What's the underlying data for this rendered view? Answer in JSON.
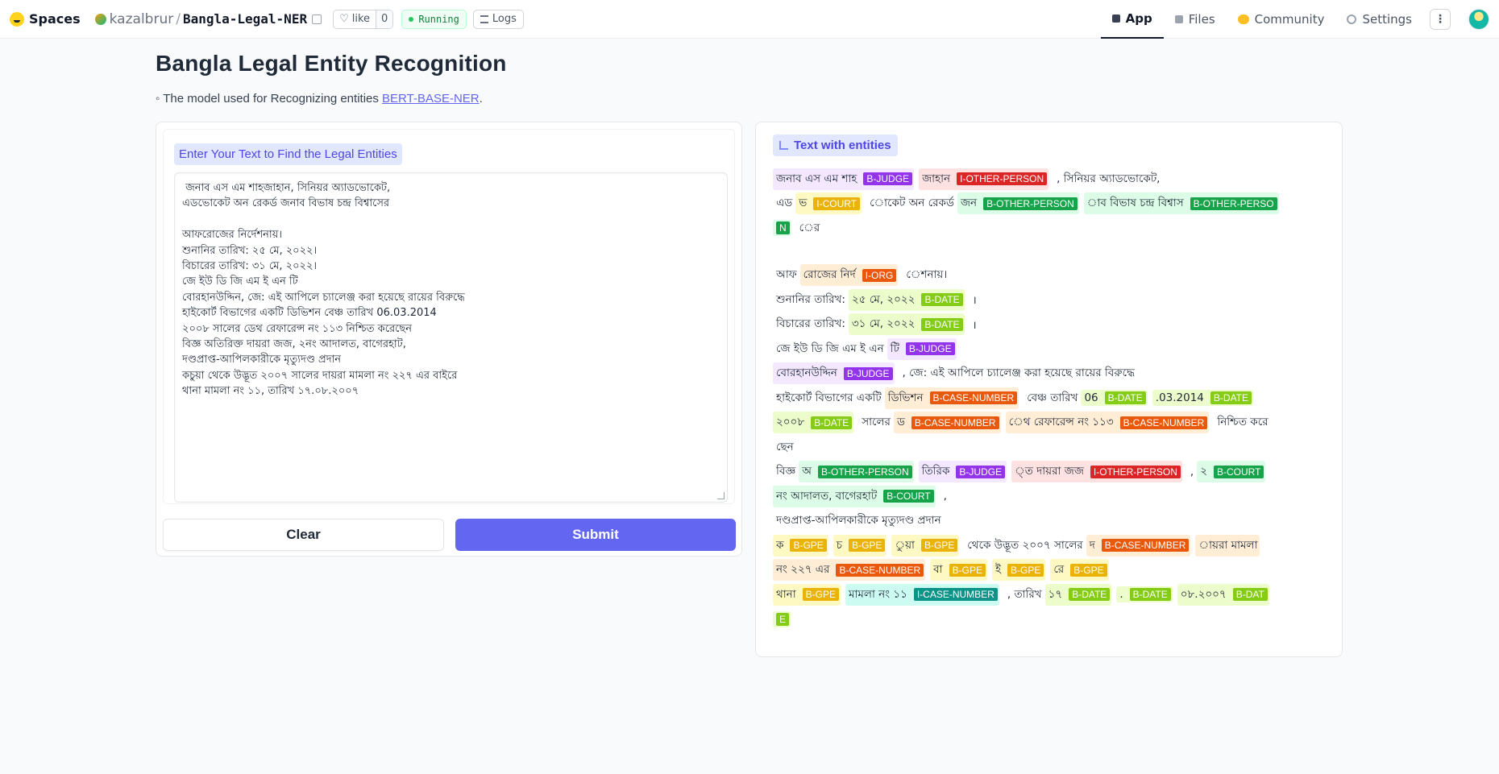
{
  "header": {
    "brand": "Spaces",
    "owner": "kazalbrur",
    "repo": "Bangla-Legal-NER",
    "like_label": "like",
    "like_count": "0",
    "status": "Running",
    "logs_label": "Logs",
    "tabs": [
      {
        "label": "App",
        "icon": "app-icon",
        "active": true
      },
      {
        "label": "Files",
        "icon": "files-icon",
        "active": false
      },
      {
        "label": "Community",
        "icon": "community-icon",
        "active": false
      },
      {
        "label": "Settings",
        "icon": "settings-icon",
        "active": false
      }
    ]
  },
  "page": {
    "title": "Bangla Legal Entity Recognition",
    "desc_prefix": "The model used for Recognizing entities",
    "desc_link": "BERT-BASE-NER",
    "desc_suffix": "."
  },
  "input": {
    "label": "Enter Your Text to Find the Legal Entities",
    "lines": [
      " জনাব এস এম শাহজাহান, সিনিয়র অ্যাডভোকেট,",
      "এডভোকেট অন রেকর্ড জনাব বিভাষ চন্দ্র বিশ্বাসের",
      "",
      "আফরোজের নির্দেশনায়।",
      "শুনানির তারিখ: ২৫ মে, ২০২২।",
      "বিচারের তারিখ: ৩১ মে, ২০২২।",
      "জে ইউ ডি জি এম ই এন টি",
      "বোরহানউদ্দিন, জে: এই আপিলে চ্যালেঞ্জ করা হয়েছে রায়ের বিরুদ্ধে",
      "হাইকোর্ট বিভাগের একটি ডিভিশন বেঞ্চ তারিখ 06.03.2014",
      "২০০৮ সালের ডেথ রেফারেন্স নং ১১৩ নিশ্চিত করেছেন",
      "বিজ্ঞ অতিরিক্ত দায়রা জজ, ২নং আদালত, বাগেরহাট,",
      "দণ্ডপ্রাপ্ত-আপিলকারীকে মৃত্যুদণ্ড প্রদান",
      "কচুয়া থেকে উদ্ভূত ২০০৭ সালের দায়রা মামলা নং ২২৭ এর বাইরে",
      "থানা মামলা নং ১১, তারিখ ১৭.০৮.২০০৭"
    ],
    "clear_label": "Clear",
    "submit_label": "Submit"
  },
  "output": {
    "label": "Text with entities",
    "rows": [
      [
        {
          "t": "জনাব এস এম শাহ",
          "l": "B-JUDGE",
          "c": "judge"
        },
        {
          "t": "জাহান",
          "l": "I-OTHER-PERSON",
          "c": "other"
        },
        {
          "t": ", সিনিয়র অ্যাডভোকেট,"
        }
      ],
      [
        {
          "t": "এড"
        },
        {
          "t": "ভ",
          "l": "I-COURT",
          "c": "court"
        },
        {
          "t": "োকেট অন রেকর্ড"
        },
        {
          "t": "জন",
          "l": "B-OTHER-PERSON",
          "c": "bop"
        },
        {
          "t": "াব বিভাষ চন্দ্র বিশ্বাস",
          "l": "B-OTHER-PERSO",
          "c": "bop"
        }
      ],
      [
        {
          "t": "",
          "l": "N",
          "c": "bop"
        },
        {
          "t": "ের"
        }
      ],
      [],
      [
        {
          "t": "আফ"
        },
        {
          "t": "রোজের নির্দ",
          "l": "I-ORG",
          "c": "org"
        },
        {
          "t": "েশনায়।"
        }
      ],
      [
        {
          "t": "শুনানির তারিখ:"
        },
        {
          "t": "২৫ মে, ২০২২",
          "l": "B-DATE",
          "c": "date"
        },
        {
          "t": "।"
        }
      ],
      [
        {
          "t": "বিচারের তারিখ:"
        },
        {
          "t": "৩১ মে, ২০২২",
          "l": "B-DATE",
          "c": "date"
        },
        {
          "t": "।"
        }
      ],
      [
        {
          "t": "জে ইউ ডি জি এম ই এন"
        },
        {
          "t": "টি",
          "l": "B-JUDGE",
          "c": "judge"
        }
      ],
      [
        {
          "t": "বোরহানউদ্দিন",
          "l": "B-JUDGE",
          "c": "judge"
        },
        {
          "t": ", জে: এই আপিলে চ্যালেঞ্জ করা হয়েছে রায়ের বিরুদ্ধে"
        }
      ],
      [
        {
          "t": "হাইকোর্ট বিভাগের একটি"
        },
        {
          "t": "ডিভিশন",
          "l": "B-CASE-NUMBER",
          "c": "case"
        },
        {
          "t": "বেঞ্চ তারিখ"
        },
        {
          "t": "06",
          "l": "B-DATE",
          "c": "date"
        },
        {
          "t": ".03.2014",
          "l": "B-DATE",
          "c": "date"
        }
      ],
      [
        {
          "t": "২০০৮",
          "l": "B-DATE",
          "c": "date"
        },
        {
          "t": "সালের"
        },
        {
          "t": "ড",
          "l": "B-CASE-NUMBER",
          "c": "case"
        },
        {
          "t": "েথ রেফারেন্স নং ১১৩",
          "l": "B-CASE-NUMBER",
          "c": "case"
        },
        {
          "t": "নিশ্চিত করে"
        }
      ],
      [
        {
          "t": "ছেন"
        }
      ],
      [
        {
          "t": "বিজ্ঞ"
        },
        {
          "t": "অ",
          "l": "B-OTHER-PERSON",
          "c": "bop"
        },
        {
          "t": "তিরিক",
          "l": "B-JUDGE",
          "c": "judge"
        },
        {
          "t": "্ত দায়রা জজ",
          "l": "I-OTHER-PERSON",
          "c": "other"
        },
        {
          "t": ","
        },
        {
          "t": "২",
          "l": "B-COURT",
          "c": "bcourt"
        }
      ],
      [
        {
          "t": "নং আদালত, বাগেরহাট",
          "l": "B-COURT",
          "c": "bcourt"
        },
        {
          "t": ","
        }
      ],
      [
        {
          "t": "দণ্ডপ্রাপ্ত-আপিলকারীকে মৃত্যুদণ্ড প্রদান"
        }
      ],
      [
        {
          "t": "ক",
          "l": "B-GPE",
          "c": "gpe"
        },
        {
          "t": "চ",
          "l": "B-GPE",
          "c": "gpe"
        },
        {
          "t": "ুয়া",
          "l": "B-GPE",
          "c": "gpe"
        },
        {
          "t": "থেকে উদ্ভূত ২০০৭ সালের"
        },
        {
          "t": "দ",
          "l": "B-CASE-NUMBER",
          "c": "case"
        },
        {
          "t": "ায়রা মামলা",
          "c": "case"
        }
      ],
      [
        {
          "t": "নং ২২৭ এর",
          "l": "B-CASE-NUMBER",
          "c": "case"
        },
        {
          "t": "বা",
          "l": "B-GPE",
          "c": "gpe"
        },
        {
          "t": "ই",
          "l": "B-GPE",
          "c": "gpe"
        },
        {
          "t": "রে",
          "l": "B-GPE",
          "c": "gpe"
        }
      ],
      [
        {
          "t": "থানা",
          "l": "B-GPE",
          "c": "gpe"
        },
        {
          "t": "মামলা নং ১১",
          "l": "I-CASE-NUMBER",
          "c": "icase"
        },
        {
          "t": ", তারিখ"
        },
        {
          "t": "১৭",
          "l": "B-DATE",
          "c": "date"
        },
        {
          "t": ".",
          "l": "B-DATE",
          "c": "date"
        },
        {
          "t": "০৮.২০০৭",
          "l": "B-DAT",
          "c": "date"
        }
      ],
      [
        {
          "t": "",
          "l": "E",
          "c": "date"
        }
      ]
    ]
  }
}
